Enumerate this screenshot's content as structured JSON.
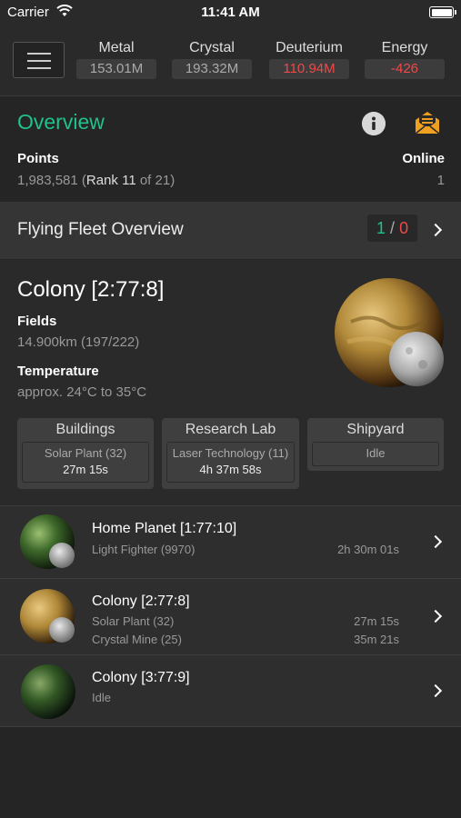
{
  "status_bar": {
    "carrier": "Carrier",
    "time": "11:41 AM"
  },
  "resources": [
    {
      "name": "Metal",
      "value": "153.01M",
      "color": "#aaaaaa"
    },
    {
      "name": "Crystal",
      "value": "193.32M",
      "color": "#aaaaaa"
    },
    {
      "name": "Deuterium",
      "value": "110.94M",
      "color": "#f04848"
    },
    {
      "name": "Energy",
      "value": "-426",
      "color": "#f04848"
    }
  ],
  "overview": {
    "title": "Overview",
    "points_label": "Points",
    "points_value": "1,983,581",
    "rank_open": " (",
    "rank_label": "Rank 11",
    "rank_of": " of 21)",
    "online_label": "Online",
    "online_value": "1"
  },
  "fleet": {
    "title": "Flying Fleet Overview",
    "own": "1",
    "separator": "/",
    "hostile": "0"
  },
  "colony": {
    "title": "Colony [2:77:8]",
    "fields_label": "Fields",
    "fields_value": "14.900km (197/222)",
    "temperature_label": "Temperature",
    "temperature_value": "approx. 24°C to 35°C",
    "boxes": [
      {
        "title": "Buildings",
        "line1": "Solar Plant (32)",
        "line2": "27m 15s"
      },
      {
        "title": "Research Lab",
        "line1": "Laser Technology (11)",
        "line2": "4h 37m 58s"
      },
      {
        "title": "Shipyard",
        "line1": "Idle"
      }
    ]
  },
  "planets": [
    {
      "name": "Home Planet [1:77:10]",
      "tasks": [
        {
          "label": "Light Fighter (9970)",
          "time": "2h 30m 01s"
        }
      ]
    },
    {
      "name": "Colony [2:77:8]",
      "tasks": [
        {
          "label": "Solar Plant (32)",
          "time": "27m 15s"
        },
        {
          "label": "Crystal Mine (25)",
          "time": "35m 21s"
        }
      ]
    },
    {
      "name": "Colony [3:77:9]",
      "tasks": [
        {
          "label": "Idle",
          "time": ""
        }
      ]
    }
  ],
  "colors": {
    "accent": "#1ec38a",
    "negative": "#f04848",
    "background": "#252525",
    "mail_icon": "#f0a020"
  }
}
